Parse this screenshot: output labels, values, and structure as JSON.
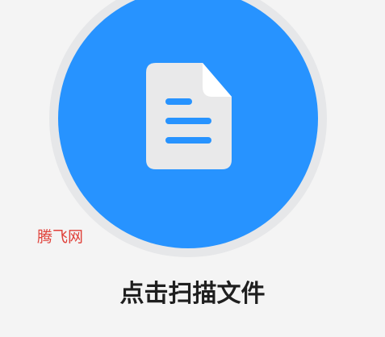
{
  "colors": {
    "background": "#f4f4f4",
    "ring": "#e6e7e9",
    "accent": "#2793ff",
    "icon_paper": "#e9e9ea",
    "icon_fold": "#ffffff",
    "icon_lines": "#2793ff",
    "watermark": "#e0413a",
    "label": "#1f1f1f"
  },
  "scan": {
    "icon": "document-icon",
    "label": "点击扫描文件"
  },
  "watermark": {
    "text": "腾飞网"
  }
}
